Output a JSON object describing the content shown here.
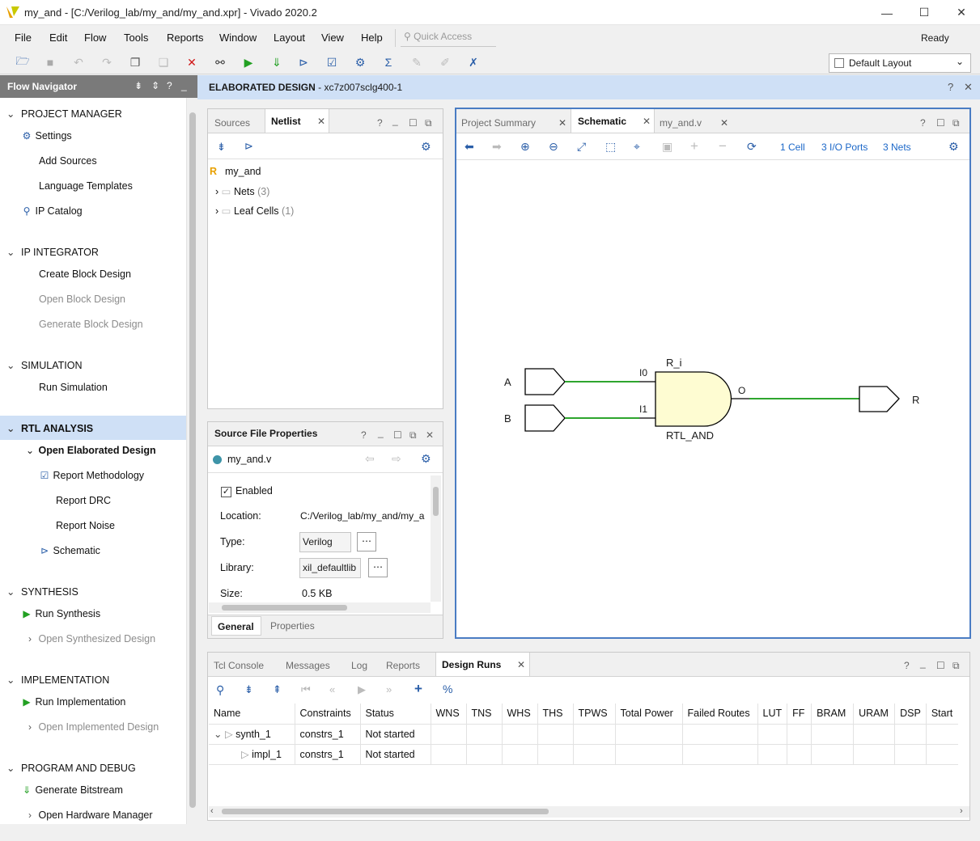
{
  "window": {
    "title": "my_and - [C:/Verilog_lab/my_and/my_and.xpr] - Vivado 2020.2",
    "controls": [
      "—",
      "☐",
      "✕"
    ]
  },
  "menu": {
    "items": [
      "File",
      "Edit",
      "Flow",
      "Tools",
      "Reports",
      "Window",
      "Layout",
      "View",
      "Help"
    ],
    "quick_access_placeholder": "Quick Access",
    "status": "Ready"
  },
  "toolbar": {
    "layout_select": "Default Layout"
  },
  "flow_navigator": {
    "title": "Flow Navigator",
    "sections": [
      {
        "label": "PROJECT MANAGER",
        "items": [
          "Settings",
          "Add Sources",
          "Language Templates",
          "IP Catalog"
        ]
      },
      {
        "label": "IP INTEGRATOR",
        "items": [
          "Create Block Design",
          "Open Block Design",
          "Generate Block Design"
        ]
      },
      {
        "label": "SIMULATION",
        "items": [
          "Run Simulation"
        ]
      },
      {
        "label": "RTL ANALYSIS",
        "items": [
          "Open Elaborated Design",
          "Report Methodology",
          "Report DRC",
          "Report Noise",
          "Schematic"
        ]
      },
      {
        "label": "SYNTHESIS",
        "items": [
          "Run Synthesis",
          "Open Synthesized Design"
        ]
      },
      {
        "label": "IMPLEMENTATION",
        "items": [
          "Run Implementation",
          "Open Implemented Design"
        ]
      },
      {
        "label": "PROGRAM AND DEBUG",
        "items": [
          "Generate Bitstream",
          "Open Hardware Manager"
        ]
      }
    ]
  },
  "design_header": {
    "title": "ELABORATED DESIGN",
    "part": " - xc7z007sclg400-1"
  },
  "sources_panel": {
    "tabs": [
      "Sources",
      "Netlist"
    ],
    "top": "my_and",
    "nets_label": "Nets",
    "nets_count": "(3)",
    "cells_label": "Leaf Cells",
    "cells_count": "(1)"
  },
  "file_props": {
    "title": "Source File Properties",
    "file": "my_and.v",
    "enabled_label": "Enabled",
    "location_label": "Location:",
    "location_value": "C:/Verilog_lab/my_and/my_a",
    "type_label": "Type:",
    "type_value": "Verilog",
    "library_label": "Library:",
    "library_value": "xil_defaultlib",
    "size_label": "Size:",
    "size_value": "0.5 KB",
    "tabs": [
      "General",
      "Properties"
    ]
  },
  "schematic": {
    "tabs": [
      "Project Summary",
      "Schematic",
      "my_and.v"
    ],
    "cells": "1 Cell",
    "ports": "3 I/O Ports",
    "nets": "3 Nets",
    "inputs": [
      "A",
      "B"
    ],
    "output": "R",
    "instance": "R_i",
    "pins": [
      "I0",
      "I1",
      "O"
    ],
    "cell_type": "RTL_AND"
  },
  "bottom_panel": {
    "tabs": [
      "Tcl Console",
      "Messages",
      "Log",
      "Reports",
      "Design Runs"
    ],
    "columns": [
      "Name",
      "Constraints",
      "Status",
      "WNS",
      "TNS",
      "WHS",
      "THS",
      "TPWS",
      "Total Power",
      "Failed Routes",
      "LUT",
      "FF",
      "BRAM",
      "URAM",
      "DSP",
      "Start"
    ],
    "rows": [
      {
        "name": "synth_1",
        "constraints": "constrs_1",
        "status": "Not started"
      },
      {
        "name": "impl_1",
        "constraints": "constrs_1",
        "status": "Not started"
      }
    ]
  },
  "colors": {
    "accent_blue": "#1b67c8",
    "selection": "#cfe0f6",
    "wire_green": "#2ea52e",
    "cell_fill": "#fefcd2"
  }
}
